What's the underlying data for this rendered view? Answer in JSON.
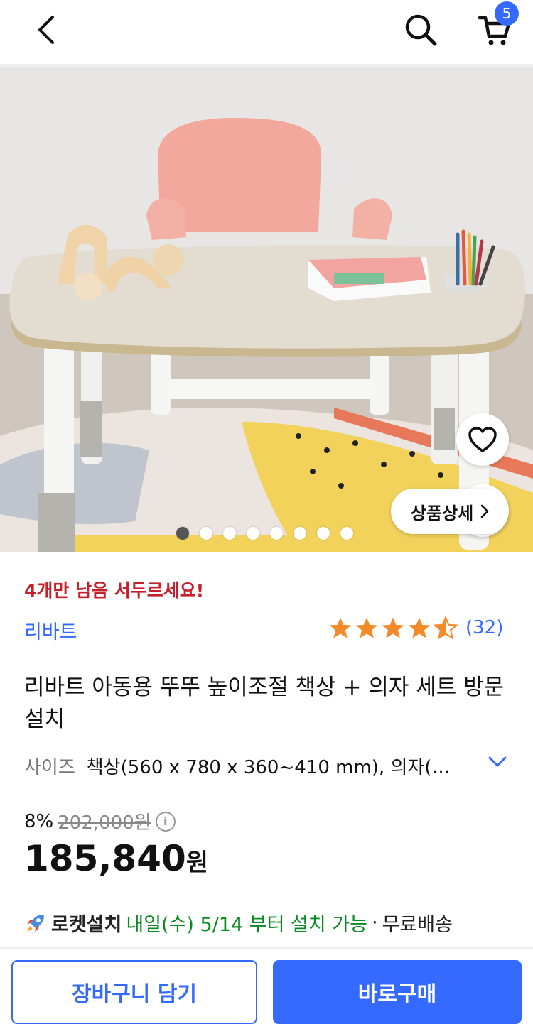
{
  "header": {
    "cart_count": "5",
    "icons": [
      "back-arrow-icon",
      "search-icon",
      "cart-icon"
    ]
  },
  "hero": {
    "detail_button_label": "상품상세",
    "image_count": 8,
    "active_index": 0
  },
  "product": {
    "stock_notice": "4개만 남음 서두르세요!",
    "brand": "리바트",
    "rating": 4.5,
    "review_count": "(32)",
    "title": "리바트 아동용 뚜뚜 높이조절 책상 + 의자 세트 방문설치",
    "option_label": "사이즈",
    "option_value": "책상(560 x 780 x 360~410 mm), 의자(…",
    "discount_rate": "8%",
    "original_price": "202,000원",
    "price_number": "185,840",
    "price_unit": "원"
  },
  "delivery": {
    "rocket_label": "로켓설치",
    "schedule": "내일(수) 5/14 부터 설치 가능",
    "separator": " · ",
    "shipping": "무료배송"
  },
  "actions": {
    "add_to_cart": "장바구니 담기",
    "buy_now": "바로구매"
  },
  "colors": {
    "accent": "#346aff",
    "warning": "#c8202b",
    "success": "#0b8a24",
    "star": "#f58a2a"
  }
}
